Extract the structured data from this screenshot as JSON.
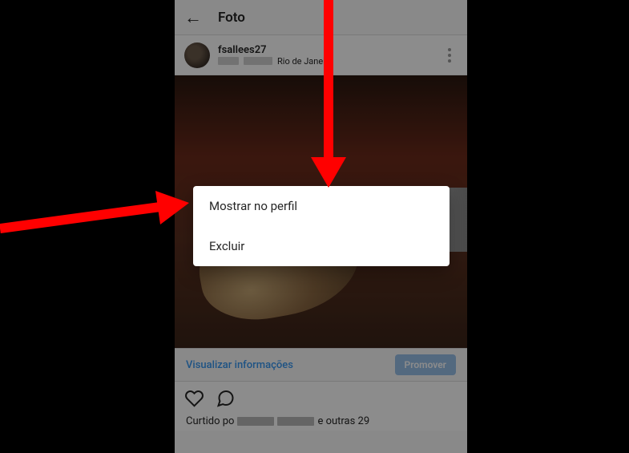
{
  "header": {
    "title": "Foto"
  },
  "post": {
    "username": "fsallees27",
    "location": "Rio de Janeiro"
  },
  "insights": {
    "view_label": "Visualizar informações",
    "promote_label": "Promover"
  },
  "likes": {
    "prefix": "Curtido po",
    "suffix": "e outras 29"
  },
  "modal": {
    "option_show": "Mostrar no perfil",
    "option_delete": "Excluir"
  }
}
